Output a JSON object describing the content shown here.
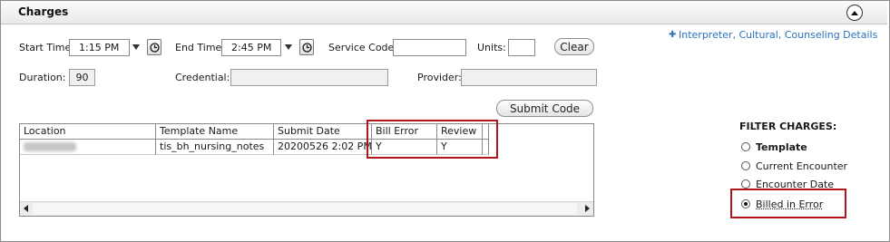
{
  "section": {
    "title": "Charges",
    "collapse_icon": "chevron-up-circle-icon"
  },
  "form": {
    "start_time": {
      "label": "Start Time:",
      "value": "1:15 PM"
    },
    "end_time": {
      "label": "End Time:",
      "value": "2:45 PM"
    },
    "service_code": {
      "label": "Service Code:",
      "value": ""
    },
    "units": {
      "label": "Units:",
      "value": ""
    },
    "clear_label": "Clear",
    "duration": {
      "label": "Duration:",
      "value": "90"
    },
    "credential": {
      "label": "Credential:",
      "value": ""
    },
    "provider": {
      "label": "Provider:",
      "value": ""
    },
    "submit_label": "Submit Code",
    "details_link": "Interpreter, Cultural, Counseling Details",
    "details_link_icon": "plus-icon"
  },
  "charges_table": {
    "columns": [
      "Location",
      "Template Name",
      "Submit Date",
      "Bill Error",
      "Review"
    ],
    "rows": [
      {
        "location": "",
        "template_name": "tis_bh_nursing_notes",
        "submit_date": "20200526 2:02 PM",
        "bill_error": "Y",
        "review": "Y"
      }
    ]
  },
  "filter": {
    "title": "FILTER CHARGES:",
    "options": [
      {
        "label": "Template",
        "checked": false
      },
      {
        "label": "Current Encounter",
        "checked": false
      },
      {
        "label": "Encounter Date",
        "checked": false
      },
      {
        "label": "Billed in Error",
        "checked": true
      }
    ]
  },
  "colors": {
    "highlight": "#b3141c",
    "link": "#2b6fbd"
  }
}
